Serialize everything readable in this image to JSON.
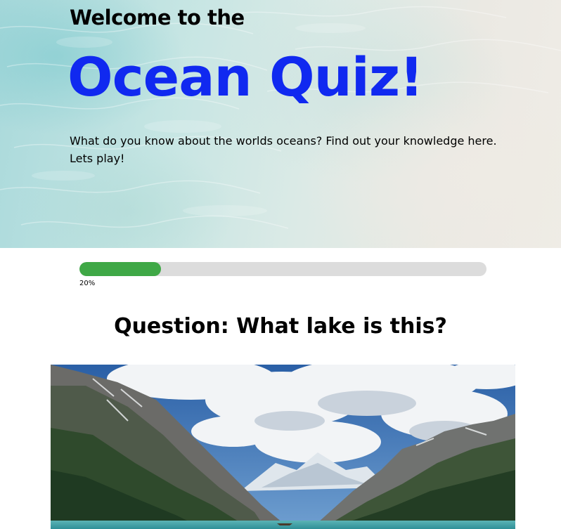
{
  "hero": {
    "welcome": "Welcome to the",
    "title": "Ocean Quiz!",
    "description": "What do you know about the worlds oceans? Find out your knowledge here. Lets play!",
    "title_color": "#1029f0"
  },
  "progress": {
    "percent": 20,
    "label": "20%",
    "fill_color": "#3fa846"
  },
  "question": {
    "text": "Question: What lake is this?"
  }
}
